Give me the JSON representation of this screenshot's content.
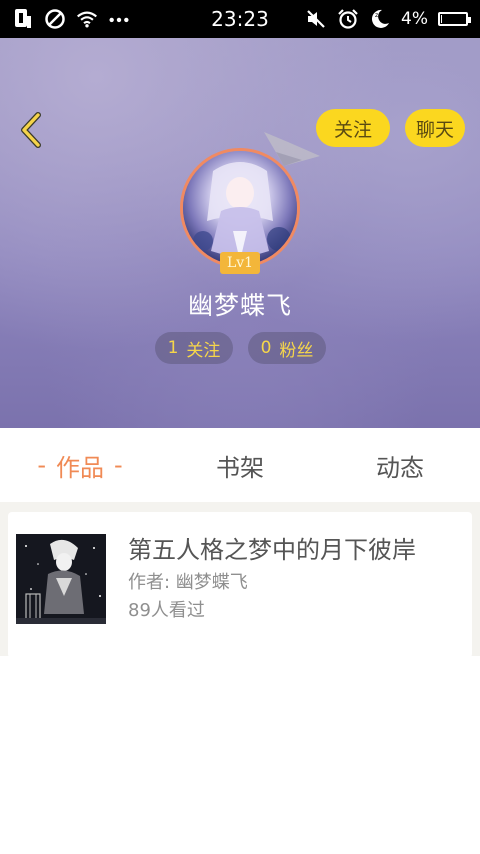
{
  "status_bar": {
    "time": "23:23",
    "battery": "4%",
    "battery_level": 0.04,
    "left_icons": [
      "sim-icon",
      "blocked-icon",
      "wifi-icon",
      "more-dots-icon"
    ],
    "right_icons": [
      "mute-icon",
      "alarm-icon",
      "night-mode-icon",
      "battery-icon"
    ]
  },
  "header": {
    "follow_label": "关注",
    "chat_label": "聊天",
    "level": "Lv1",
    "username": "幽梦蝶飞",
    "following_count": "1",
    "following_label": "关注",
    "fans_count": "0",
    "fans_label": "粉丝",
    "accent_color": "#fbd71f",
    "avatar_ring_color": "#f08a62"
  },
  "tabs": [
    {
      "label": "作品",
      "active": true
    },
    {
      "label": "书架",
      "active": false
    },
    {
      "label": "动态",
      "active": false
    }
  ],
  "works": [
    {
      "title": "第五人格之梦中的月下彼岸",
      "author": "作者: 幽梦蝶飞",
      "views": "89人看过"
    }
  ],
  "colors": {
    "active_tab": "#f08a55"
  }
}
